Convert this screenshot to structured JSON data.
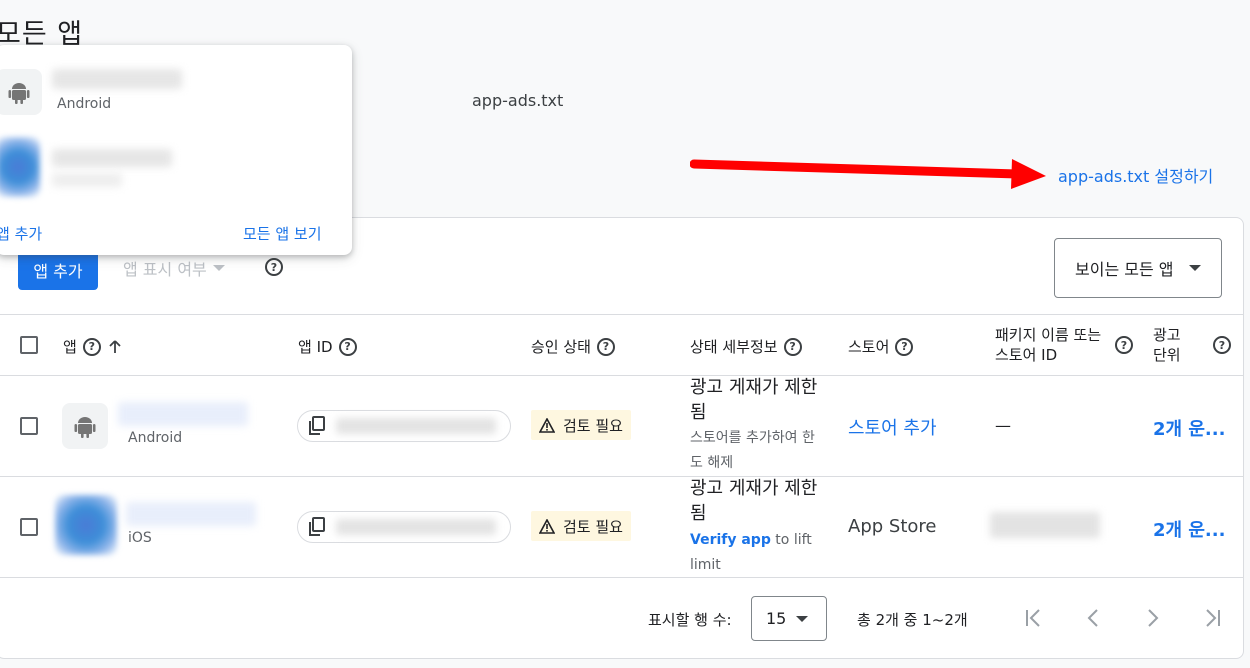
{
  "page": {
    "title": "모든 앱"
  },
  "header": {
    "appads_label": "app-ads.txt",
    "setup_link": "app-ads.txt 설정하기",
    "arrow_color": "#ff0000"
  },
  "toolbar": {
    "add_app_label": "앱 추가",
    "filter_label": "앱 표시 여부",
    "visible_apps_label": "보이는 모든 앱"
  },
  "table": {
    "columns": {
      "app": "앱",
      "app_id": "앱 ID",
      "approval": "승인 상태",
      "status_detail": "상태 세부정보",
      "store": "스토어",
      "package_line1": "패키지 이름 또는",
      "package_line2": "스토어 ID",
      "ad_units_line1": "광고",
      "ad_units_line2": "단위"
    },
    "rows": [
      {
        "platform": "Android",
        "approval": "검토 필요",
        "status_main": "광고 게재가 제한됨",
        "status_sub": "스토어를 추가하여 한도 해제",
        "store": "스토어 추가",
        "package": "—",
        "ad_units": "2개 운..."
      },
      {
        "platform": "iOS",
        "approval": "검토 필요",
        "status_main": "광고 게재가 제한됨",
        "verify_link": "Verify app",
        "verify_rest": " to lift limit",
        "store": "App Store",
        "ad_units": "2개 운..."
      }
    ]
  },
  "pagination": {
    "rows_label": "표시할 행 수:",
    "rows_value": "15",
    "range": "총 2개 중 1~2개"
  },
  "popup": {
    "platform": "Android",
    "add_app": "앱 추가",
    "view_all": "모든 앱 보기"
  },
  "colors": {
    "accent": "#1a73e8",
    "badge_bg": "#fef7e0"
  }
}
